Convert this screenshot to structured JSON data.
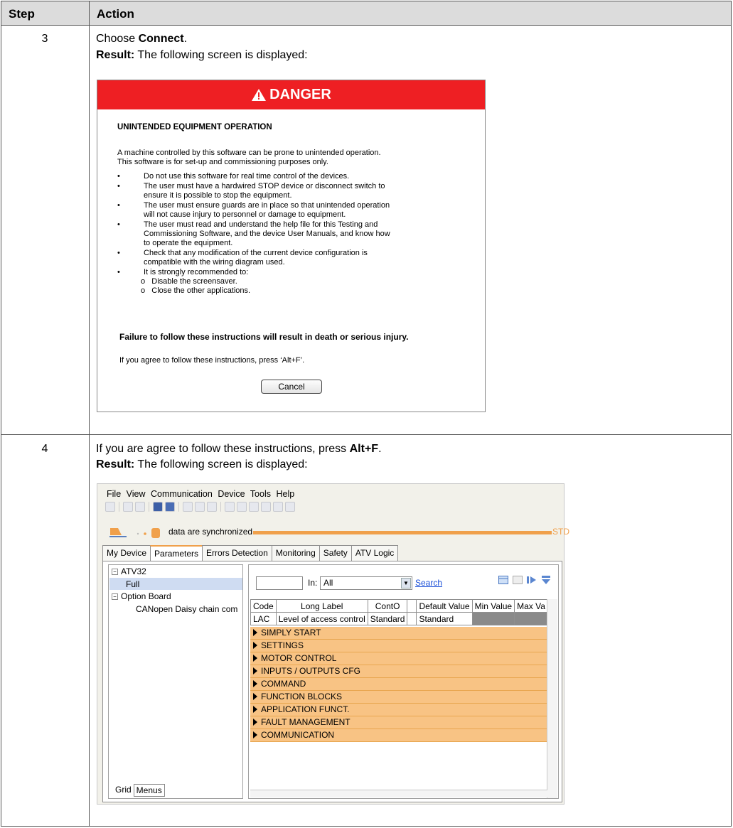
{
  "table": {
    "header_step": "Step",
    "header_action": "Action"
  },
  "step3": {
    "number": "3",
    "line1_prefix": "Choose ",
    "line1_bold": "Connect",
    "line1_suffix": ".",
    "result_label": "Result:",
    "result_text": " The following screen is displayed:"
  },
  "danger_dialog": {
    "banner": "DANGER",
    "heading": "UNINTENDED EQUIPMENT OPERATION",
    "intro": [
      "A machine controlled by this software can be prone to unintended operation.",
      "This software is for set-up and commissioning purposes only."
    ],
    "bullets": [
      [
        "Do not use this software for real time control of the devices."
      ],
      [
        "The user must have a hardwired STOP device or disconnect switch to",
        "ensure it is possible to stop the equipment."
      ],
      [
        "The user must ensure guards are in place so that unintended operation",
        "will not cause injury to personnel or damage to equipment."
      ],
      [
        "The user must read and understand the help file for this Testing and",
        "Commissioning Software, and the device User Manuals, and know how",
        "to operate the equipment."
      ],
      [
        "Check that any modification of the current device configuration is",
        "compatible with the wiring diagram used."
      ],
      [
        "It is strongly recommended to:"
      ]
    ],
    "bullet_marker": "•",
    "sub_marker": "o",
    "sub_bullets": [
      "Disable the screensaver.",
      "Close the other applications."
    ],
    "warning": "Failure to follow these instructions will result in death or serious injury.",
    "agree": "If you agree to follow these instructions, press ‘Alt+F’.",
    "cancel_button": "Cancel"
  },
  "step4": {
    "number": "4",
    "line1_prefix": "If you are agree to follow these instructions, press ",
    "line1_bold": "Alt+F",
    "line1_suffix": ".",
    "result_label": "Result:",
    "result_text": " The following screen is displayed:"
  },
  "app_window": {
    "menu": [
      "File",
      "View",
      "Communication",
      "Device",
      "Tools",
      "Help"
    ],
    "sync_text": "data are synchronized",
    "sync_status": "STD",
    "tabs": [
      "My Device",
      "Parameters",
      "Errors Detection",
      "Monitoring",
      "Safety",
      "ATV Logic"
    ],
    "active_tab": "Parameters",
    "tree": {
      "root": "ATV32",
      "selected": "Full",
      "option_board": "Option Board",
      "child": "CANopen Daisy chain com",
      "expander": "−"
    },
    "bottom_tabs": [
      "Grid",
      "Menus"
    ],
    "search": {
      "value": "",
      "in_label": "In:",
      "in_value": "All",
      "dropdown_arrow": "▼",
      "search_link": "Search"
    },
    "grid": {
      "columns": [
        "Code",
        "Long Label",
        "ContO",
        "",
        "Default Value",
        "Min Value",
        "Max Va"
      ],
      "row": [
        "LAC",
        "Level of access control",
        "Standard",
        "",
        "Standard",
        "",
        ""
      ]
    },
    "menus": [
      "SIMPLY START",
      "SETTINGS",
      "MOTOR CONTROL",
      "INPUTS / OUTPUTS CFG",
      "COMMAND",
      "FUNCTION BLOCKS",
      "APPLICATION FUNCT.",
      "FAULT MANAGEMENT",
      "COMMUNICATION"
    ],
    "colors": {
      "accent": "#f0a04b",
      "menu_row": "#f8c384",
      "danger": "#ee1f23",
      "link": "#1a4fd8"
    }
  }
}
